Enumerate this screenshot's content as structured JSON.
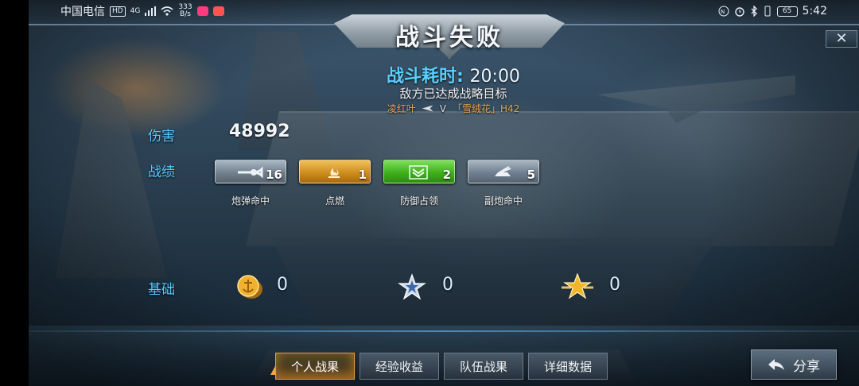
{
  "status_bar": {
    "carrier": "中国电信",
    "tag": "HD",
    "signal": "4G",
    "net_speed_value": "333",
    "net_speed_unit": "B/s",
    "battery": "65",
    "time": "5:42"
  },
  "header": {
    "title": "战斗失败",
    "close_label": "✕"
  },
  "summary": {
    "time_label": "战斗耗时:",
    "time_value": "20:00",
    "result_message": "敌方已达成战略目标",
    "player_name": "凌红叶",
    "vs": "V",
    "opponent": "「雪绒花」H42"
  },
  "stats": {
    "damage_label": "伤害",
    "damage_value": "48992",
    "achievements_label": "战绩",
    "achievements": [
      {
        "label": "炮弹命中",
        "count": "16",
        "icon": "shell-hit-icon",
        "color": "#73818f"
      },
      {
        "label": "点燃",
        "count": "1",
        "icon": "fire-icon",
        "color": "#d08e1f"
      },
      {
        "label": "防御占领",
        "count": "2",
        "icon": "defense-capture-icon",
        "color": "#3fb01c"
      },
      {
        "label": "副炮命中",
        "count": "5",
        "icon": "secondary-gun-icon",
        "color": "#718090"
      }
    ],
    "base_label": "基础",
    "base_rewards": [
      {
        "icon": "gold-coin-icon",
        "value": "0"
      },
      {
        "icon": "silver-star-icon",
        "value": "0"
      },
      {
        "icon": "gold-star-icon",
        "value": "0"
      }
    ]
  },
  "tabs": {
    "items": [
      "个人战果",
      "经验收益",
      "队伍战果",
      "详细数据"
    ],
    "active_index": 0
  },
  "share": {
    "label": "分享"
  }
}
